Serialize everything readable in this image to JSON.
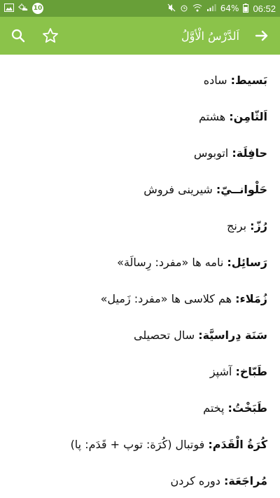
{
  "status_bar": {
    "time": "06:52",
    "battery": "64%",
    "notification_badge": "10"
  },
  "app_bar": {
    "title": "اَلدَّرْسُ الْأوَّلُ",
    "back_icon": "arrow-right-icon",
    "search_icon": "search-icon",
    "star_icon": "star-outline-icon"
  },
  "entries": [
    {
      "term": "بَسيط:",
      "definition": "ساده"
    },
    {
      "term": "اَلثّامِن:",
      "definition": "هشتم"
    },
    {
      "term": "حافِلَة:",
      "definition": "اتوبوس"
    },
    {
      "term": "حَلْوانــيّ:",
      "definition": "شیرینی فروش"
    },
    {
      "term": "رُزّ:",
      "definition": "برنج"
    },
    {
      "term": "رَسائِل:",
      "definition": "نامه ها «مفرد: رِسالَة»"
    },
    {
      "term": "زُمَلاء:",
      "definition": "هم کلاسی ها «مفرد: زَمیل»"
    },
    {
      "term": "سَنَة دِراسيَّة:",
      "definition": "سال تحصیلی"
    },
    {
      "term": "طَبّاخ:",
      "definition": "آشپز"
    },
    {
      "term": "طَبَخْتُ:",
      "definition": "پختم"
    },
    {
      "term": "كُرَةُ الْقَدَم:",
      "definition": "فوتبال (کُرَة: توپ + قَدَم: پا)"
    },
    {
      "term": "مُراجَعَة:",
      "definition": "دوره کردن"
    }
  ],
  "colors": {
    "status_bar": "#689f38",
    "app_bar": "#8bc34a",
    "text": "#111111"
  }
}
